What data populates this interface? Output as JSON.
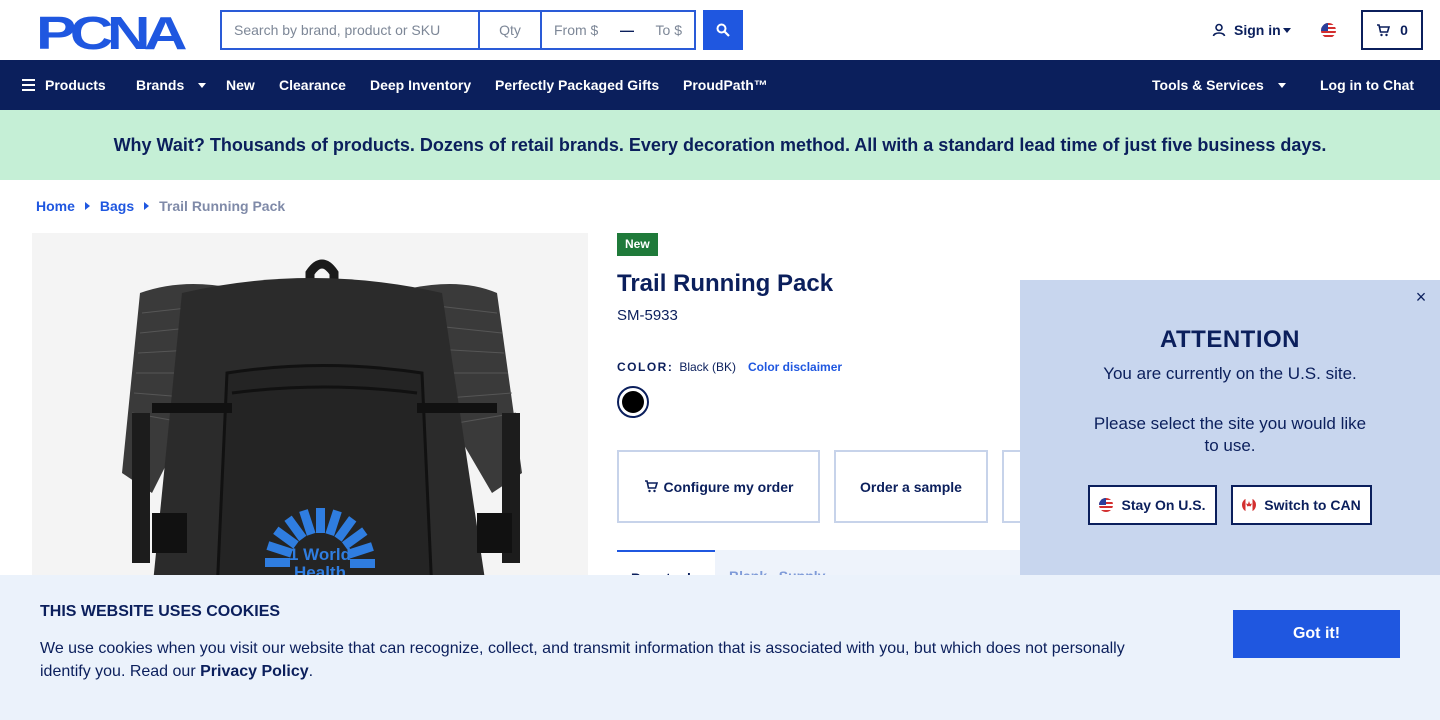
{
  "header": {
    "logo_text": "PCNA",
    "search_placeholder": "Search by brand, product or SKU",
    "qty_placeholder": "Qty",
    "price_from_placeholder": "From $",
    "price_to_placeholder": "To $",
    "search_icon": "search-icon",
    "signin_label": "Sign in",
    "cart_count": "0",
    "region_flag": "us-flag-icon"
  },
  "nav": {
    "items": [
      {
        "label": "Products"
      },
      {
        "label": "Brands"
      },
      {
        "label": "New"
      },
      {
        "label": "Clearance"
      },
      {
        "label": "Deep Inventory"
      },
      {
        "label": "Perfectly Packaged Gifts"
      },
      {
        "label": "ProudPath™"
      }
    ],
    "tools_label": "Tools & Services",
    "chat_label": "Log in to Chat"
  },
  "promo": {
    "text": "Why Wait? Thousands of products. Dozens of retail brands. Every decoration method. All with a standard lead time of just five business days."
  },
  "breadcrumb": [
    "Home",
    "Bags",
    "Trail Running Pack"
  ],
  "product": {
    "badge": "New",
    "title": "Trail Running Pack",
    "sku": "SM-5933",
    "color_label": "COLOR:",
    "color_value": "Black (BK)",
    "color_disclaimer": "Color disclaimer",
    "swatch_color": "#000000",
    "imprint_logo_text_1": "1 World",
    "imprint_logo_text_2": "Health",
    "actions": {
      "configure": "Configure my order",
      "sample": "Order a sample"
    },
    "tabs": {
      "first": "Pre-stock",
      "second": "Blank   Supply"
    }
  },
  "attention": {
    "title": "ATTENTION",
    "line1": "You are currently on the U.S. site.",
    "line2": "Please select the site you would like to use.",
    "stay_label": "Stay On U.S.",
    "switch_label": "Switch to CAN",
    "close_symbol": "×"
  },
  "cookie": {
    "title": "THIS WEBSITE USES COOKIES",
    "text_before": "We use cookies when you visit our website that can recognize, collect, and transmit information that is associated with you, but which does not personally identify you. Read our ",
    "privacy_link": "Privacy Policy",
    "text_after": ".",
    "button": "Got it!"
  },
  "colors": {
    "navy": "#0b1f5c",
    "brand_blue": "#1f57e0",
    "promo_bg": "#c5efd6",
    "badge_green": "#1f7a3a",
    "popup_bg": "#c8d6ee",
    "cookie_bg": "#ebf2fb"
  }
}
